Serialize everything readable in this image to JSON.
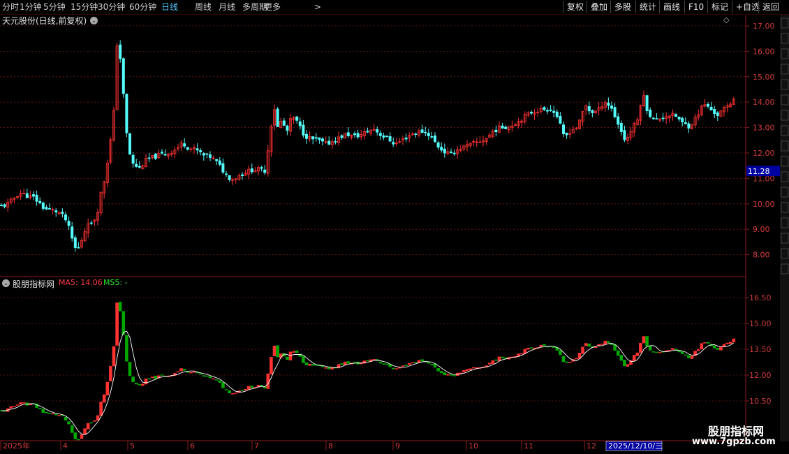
{
  "toolbar": {
    "periods": [
      "分时",
      "1分钟",
      "5分钟",
      "15分钟",
      "30分钟",
      "60分钟",
      "日线",
      "周线",
      "月线",
      "多周期",
      "更多"
    ],
    "active_period": "日线",
    "more_arrow": ">",
    "right_buttons": [
      "复权",
      "叠加",
      "多股",
      "统计",
      "画线",
      "F10",
      "标记",
      "+自选",
      "返回"
    ]
  },
  "main_panel": {
    "title": "天元股份(日线,前复权)",
    "dropdown_icon": "chevron-down-icon",
    "diamond_icon": "◇",
    "price_ticks": [
      "17.00",
      "16.00",
      "15.00",
      "14.00",
      "13.00",
      "12.00",
      "11.00",
      "10.00",
      "9.00",
      "8.00"
    ],
    "current_price": "11.28"
  },
  "sub_panel": {
    "title": "股朋指标网",
    "ma5_label": "MA5: 14.06",
    "ms5_label": "MS5: -",
    "ticks": [
      "16.50",
      "15.00",
      "13.50",
      "12.00",
      "10.50"
    ]
  },
  "time_axis": {
    "labels": [
      "2025年",
      "4",
      "5",
      "6",
      "7",
      "8",
      "9",
      "10",
      "11",
      "12"
    ],
    "cursor_date": "2025/12/10/三"
  },
  "watermark": {
    "name": "股朋指标网",
    "url": "www.7gpzb.com"
  },
  "colors": {
    "up": "#ff3232",
    "down": "#54fcfc",
    "sub_down": "#00a800",
    "ma_line": "#ffffff",
    "grid": "#7a1818",
    "active_tab": "#5bc8ff",
    "price_label_bg": "#0000a0"
  },
  "chart_data": {
    "type": "candlestick",
    "title": "天元股份(日线,前复权)",
    "ylim": [
      7.4,
      17.5
    ],
    "months": [
      "2025年",
      "4",
      "5",
      "6",
      "7",
      "8",
      "9",
      "10",
      "11",
      "12"
    ],
    "anchors": [
      [
        0,
        9.9
      ],
      [
        8,
        9.95
      ],
      [
        18,
        10.15
      ],
      [
        28,
        10.45
      ],
      [
        40,
        10.3
      ],
      [
        48,
        10.25
      ],
      [
        56,
        10.05
      ],
      [
        64,
        9.8
      ],
      [
        75,
        9.75
      ],
      [
        86,
        9.65
      ],
      [
        96,
        9.3
      ],
      [
        104,
        8.55
      ],
      [
        110,
        8.1
      ],
      [
        118,
        8.65
      ],
      [
        126,
        9.3
      ],
      [
        132,
        9.15
      ],
      [
        140,
        9.75
      ],
      [
        144,
        10.35
      ],
      [
        150,
        11.0
      ],
      [
        158,
        12.4
      ],
      [
        163,
        13.6
      ],
      [
        168,
        16.5
      ],
      [
        174,
        15.4
      ],
      [
        180,
        13.0
      ],
      [
        188,
        11.6
      ],
      [
        200,
        11.4
      ],
      [
        210,
        11.75
      ],
      [
        222,
        11.85
      ],
      [
        232,
        11.95
      ],
      [
        242,
        12.0
      ],
      [
        252,
        12.15
      ],
      [
        262,
        12.4
      ],
      [
        270,
        12.2
      ],
      [
        282,
        12.1
      ],
      [
        292,
        11.9
      ],
      [
        302,
        11.85
      ],
      [
        312,
        11.6
      ],
      [
        322,
        11.2
      ],
      [
        332,
        10.95
      ],
      [
        342,
        11.1
      ],
      [
        352,
        11.25
      ],
      [
        362,
        11.35
      ],
      [
        372,
        11.35
      ],
      [
        380,
        11.3
      ],
      [
        386,
        12.6
      ],
      [
        392,
        13.9
      ],
      [
        398,
        12.95
      ],
      [
        404,
        13.35
      ],
      [
        410,
        12.75
      ],
      [
        418,
        13.45
      ],
      [
        426,
        13.2
      ],
      [
        436,
        12.7
      ],
      [
        446,
        12.55
      ],
      [
        456,
        12.5
      ],
      [
        466,
        12.35
      ],
      [
        476,
        12.45
      ],
      [
        486,
        12.6
      ],
      [
        496,
        12.75
      ],
      [
        506,
        12.65
      ],
      [
        516,
        12.7
      ],
      [
        526,
        12.85
      ],
      [
        536,
        12.95
      ],
      [
        546,
        12.7
      ],
      [
        556,
        12.55
      ],
      [
        566,
        12.35
      ],
      [
        576,
        12.5
      ],
      [
        586,
        12.7
      ],
      [
        596,
        12.8
      ],
      [
        606,
        12.85
      ],
      [
        616,
        12.7
      ],
      [
        626,
        12.3
      ],
      [
        636,
        12.05
      ],
      [
        646,
        11.95
      ],
      [
        656,
        12.15
      ],
      [
        666,
        12.25
      ],
      [
        676,
        12.35
      ],
      [
        686,
        12.45
      ],
      [
        696,
        12.55
      ],
      [
        706,
        12.85
      ],
      [
        716,
        13.0
      ],
      [
        728,
        13.05
      ],
      [
        740,
        13.2
      ],
      [
        752,
        13.45
      ],
      [
        764,
        13.65
      ],
      [
        776,
        13.7
      ],
      [
        788,
        13.75
      ],
      [
        798,
        13.45
      ],
      [
        808,
        12.6
      ],
      [
        818,
        12.9
      ],
      [
        828,
        13.05
      ],
      [
        838,
        13.9
      ],
      [
        846,
        13.6
      ],
      [
        856,
        13.65
      ],
      [
        866,
        14.05
      ],
      [
        876,
        13.75
      ],
      [
        886,
        13.1
      ],
      [
        896,
        12.45
      ],
      [
        904,
        12.9
      ],
      [
        914,
        13.35
      ],
      [
        920,
        14.4
      ],
      [
        928,
        13.6
      ],
      [
        938,
        13.25
      ],
      [
        948,
        13.4
      ],
      [
        958,
        13.5
      ],
      [
        968,
        13.45
      ],
      [
        978,
        13.15
      ],
      [
        988,
        13.05
      ],
      [
        998,
        13.45
      ],
      [
        1008,
        13.95
      ],
      [
        1018,
        13.7
      ],
      [
        1028,
        13.5
      ],
      [
        1038,
        13.75
      ],
      [
        1048,
        14.0
      ],
      [
        1054,
        14.4
      ]
    ]
  }
}
